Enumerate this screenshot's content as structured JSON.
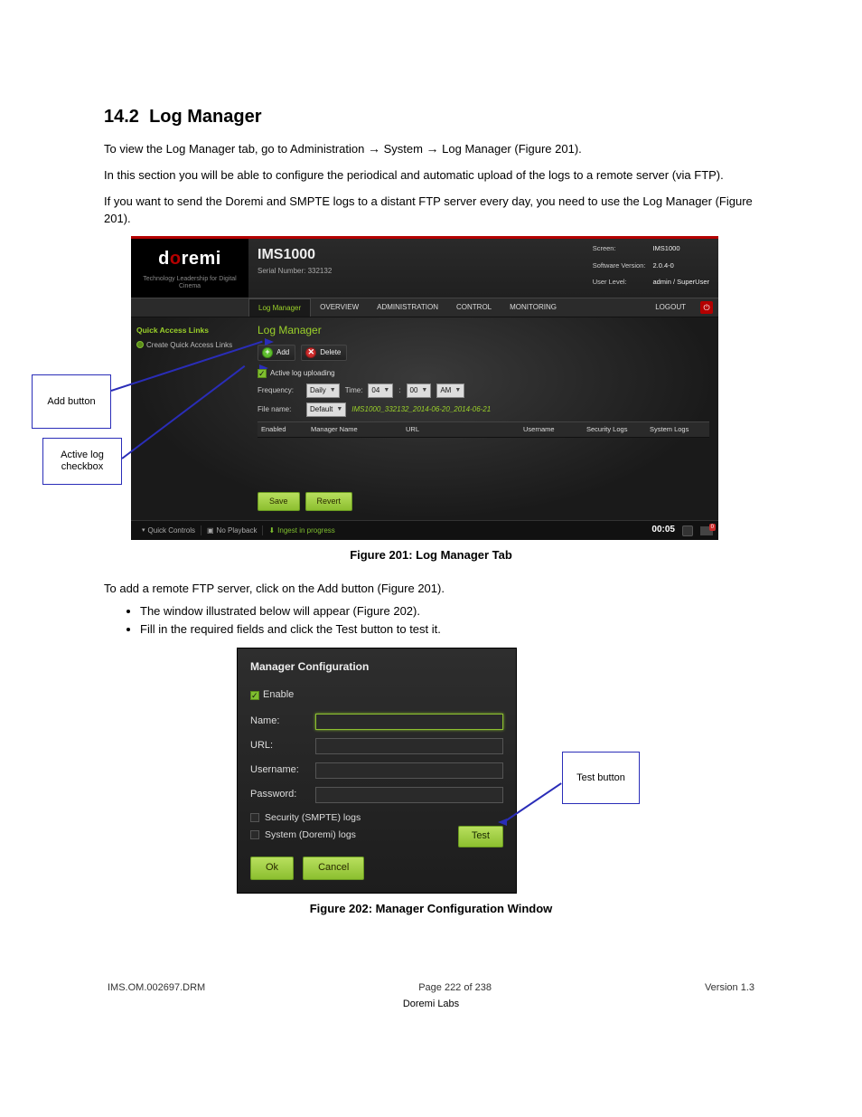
{
  "doc": {
    "section_no": "14.2",
    "section_title": "Log Manager",
    "p1_a": "To view the Log Manager tab, go to Administration ",
    "p1_b": " System ",
    "p1_c": " Log Manager (Figure 201).",
    "p2": "In this section you will be able to configure the periodical and automatic upload of the logs to a remote server (via FTP).",
    "p3": "If you want to send the Doremi and SMPTE logs to a distant FTP server every day, you need to use the Log Manager (Figure 201).",
    "fig1_caption": "Figure 201: Log Manager Tab",
    "bullet_intro": "To add a remote FTP server, click on the Add button (Figure 201).",
    "bullet1": "The window illustrated below will appear (Figure 202).",
    "bullet2": "Fill in the required fields and click the Test button to test it.",
    "fig2_caption": "Figure 202: Manager Configuration Window",
    "callout_add": "Add button",
    "callout_active": "Active log checkbox",
    "callout_test": "Test button",
    "arrow": "→"
  },
  "app": {
    "brand_d": "d",
    "brand_o": "o",
    "brand_remi": "remi",
    "tagline": "Technology Leadership for Digital Cinema",
    "model": "IMS1000",
    "serial_lbl": "Serial Number: ",
    "serial": "332132",
    "info": {
      "screen_lbl": "Screen:",
      "screen": "IMS1000",
      "sw_lbl": "Software Version:",
      "sw": "2.0.4-0",
      "user_lbl": "User Level:",
      "user": "admin / SuperUser"
    },
    "tabs": {
      "active": "Log Manager",
      "t1": "OVERVIEW",
      "t2": "ADMINISTRATION",
      "t3": "CONTROL",
      "t4": "MONITORING",
      "logout": "LOGOUT"
    },
    "sidebar": {
      "title": "Quick Access Links",
      "link": "Create Quick Access Links"
    },
    "main": {
      "title": "Log Manager",
      "add": "Add",
      "delete": "Delete",
      "active_chk": "Active log uploading",
      "freq_lbl": "Frequency:",
      "freq": "Daily",
      "time_lbl": "Time:",
      "hh": "04",
      "mm": "00",
      "ampm": "AM",
      "file_lbl": "File name:",
      "file_sel": "Default",
      "file_example": "IMS1000_332132_2014-06-20_2014-06-21",
      "cols": {
        "c1": "Enabled",
        "c2": "Manager Name",
        "c3": "URL",
        "c4": "Username",
        "c5": "Security Logs",
        "c6": "System Logs"
      },
      "save": "Save",
      "revert": "Revert"
    },
    "status": {
      "quick": "Quick Controls",
      "nopb": "No Playback",
      "ingest": "Ingest in progress",
      "time": "00:05",
      "flag_count": "0"
    }
  },
  "dlg": {
    "title": "Manager Configuration",
    "enable": "Enable",
    "name_lbl": "Name:",
    "url_lbl": "URL:",
    "user_lbl": "Username:",
    "pass_lbl": "Password:",
    "sec": "Security (SMPTE) logs",
    "sys": "System (Doremi) logs",
    "test": "Test",
    "ok": "Ok",
    "cancel": "Cancel"
  },
  "footer": {
    "left": "IMS.OM.002697.DRM",
    "center": "Page 222 of 238",
    "right": "Version 1.3",
    "copyright": "Doremi Labs"
  }
}
